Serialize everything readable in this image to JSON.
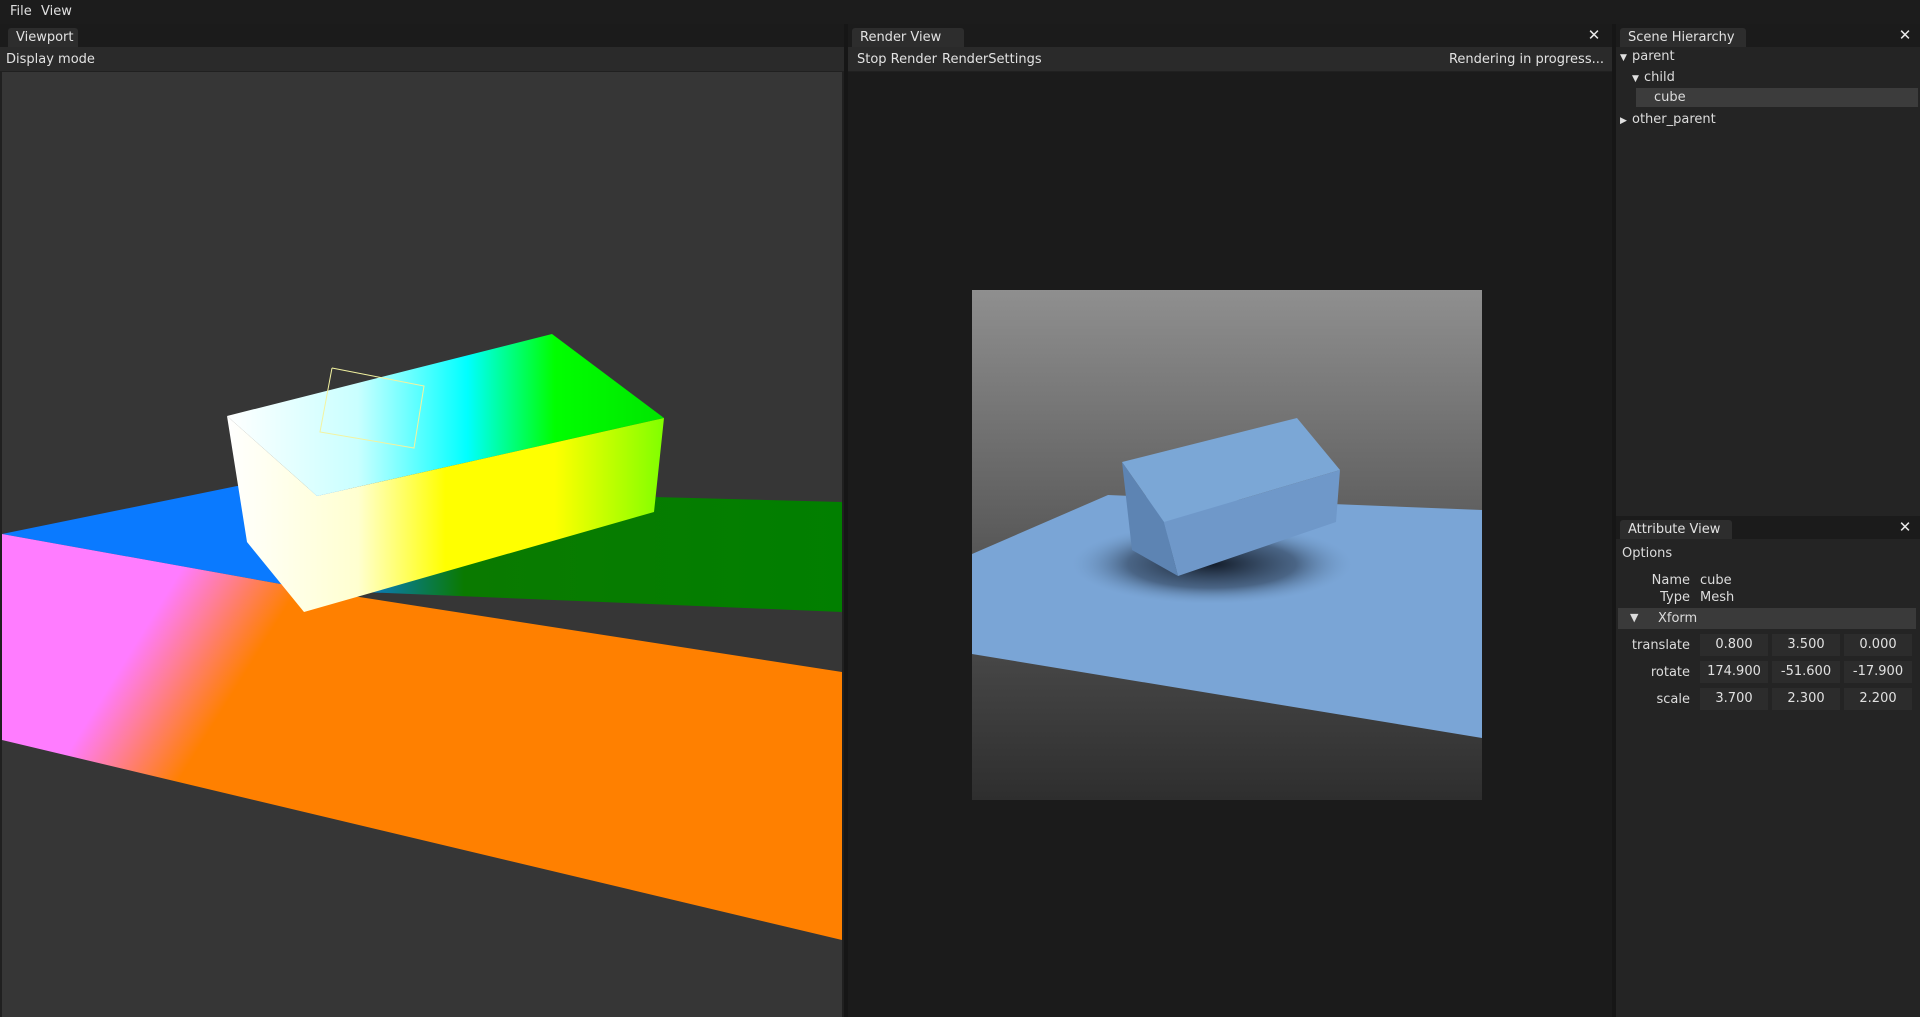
{
  "menu": {
    "file": "File",
    "view": "View"
  },
  "viewport": {
    "tab": "Viewport",
    "display_mode": "Display mode"
  },
  "render_view": {
    "tab": "Render View",
    "stop_render": "Stop Render",
    "render_settings": "RenderSettings",
    "status": "Rendering in progress..."
  },
  "scene_hierarchy": {
    "tab": "Scene Hierarchy",
    "items": [
      {
        "label": "parent",
        "expanded": true,
        "depth": 0
      },
      {
        "label": "child",
        "expanded": true,
        "depth": 1
      },
      {
        "label": "cube",
        "selected": true,
        "depth": 2
      },
      {
        "label": "other_parent",
        "expanded": false,
        "depth": 0
      }
    ]
  },
  "attribute_view": {
    "tab": "Attribute View",
    "options": "Options",
    "name_label": "Name",
    "name_value": "cube",
    "type_label": "Type",
    "type_value": "Mesh",
    "xform_label": "Xform",
    "translate": {
      "label": "translate",
      "x": "0.800",
      "y": "3.500",
      "z": "0.000"
    },
    "rotate": {
      "label": "rotate",
      "x": "174.900",
      "y": "-51.600",
      "z": "-17.900"
    },
    "scale": {
      "label": "scale",
      "x": "3.700",
      "y": "2.300",
      "z": "2.200"
    }
  },
  "icons": {
    "close": "close-icon",
    "expand": "triangle-down-icon",
    "collapse": "triangle-right-icon"
  },
  "colors": {
    "selection": "#3a3a3a",
    "render_object": "#7da7d9"
  }
}
